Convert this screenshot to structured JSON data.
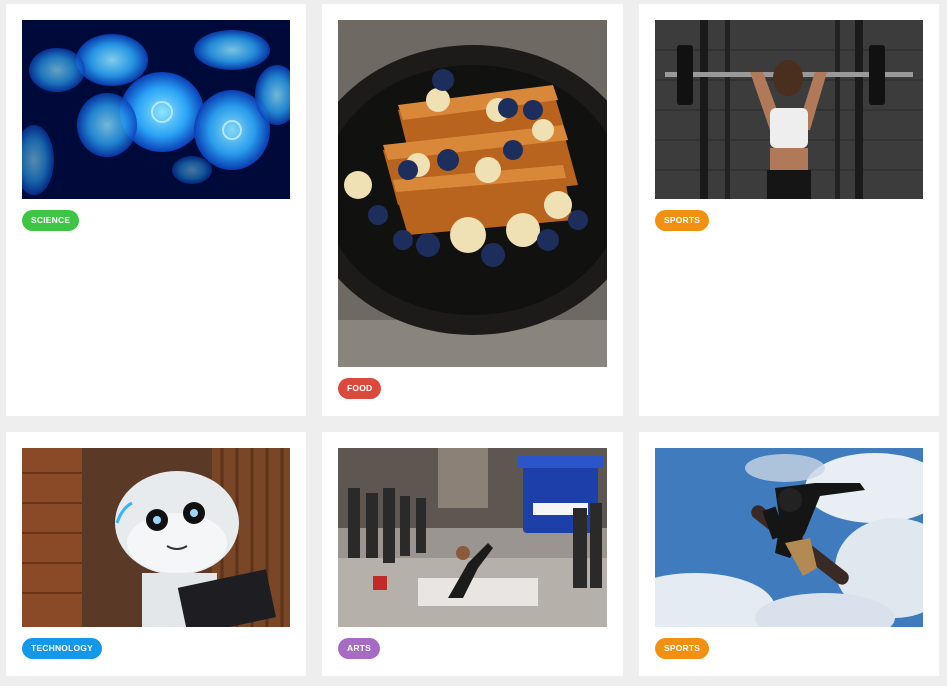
{
  "cards": [
    {
      "image_alt": "Glowing blue jellyfish in dark water",
      "tag": "SCIENCE",
      "tag_color": "#3ec545"
    },
    {
      "image_alt": "French toast stack with blueberries and banana slices",
      "tag": "FOOD",
      "tag_color": "#d94a3d"
    },
    {
      "image_alt": "Athlete lifting a barbell overhead in a gym",
      "tag": "SPORTS",
      "tag_color": "#f29111"
    },
    {
      "image_alt": "White humanoid robot holding a tablet",
      "tag": "TECHNOLOGY",
      "tag_color": "#1498ea"
    },
    {
      "image_alt": "Street breakdancer performing in front of a crowd",
      "tag": "ARTS",
      "tag_color": "#a76bc4"
    },
    {
      "image_alt": "Snowboarder mid-air against a cloudy blue sky",
      "tag": "SPORTS",
      "tag_color": "#f29111"
    }
  ]
}
